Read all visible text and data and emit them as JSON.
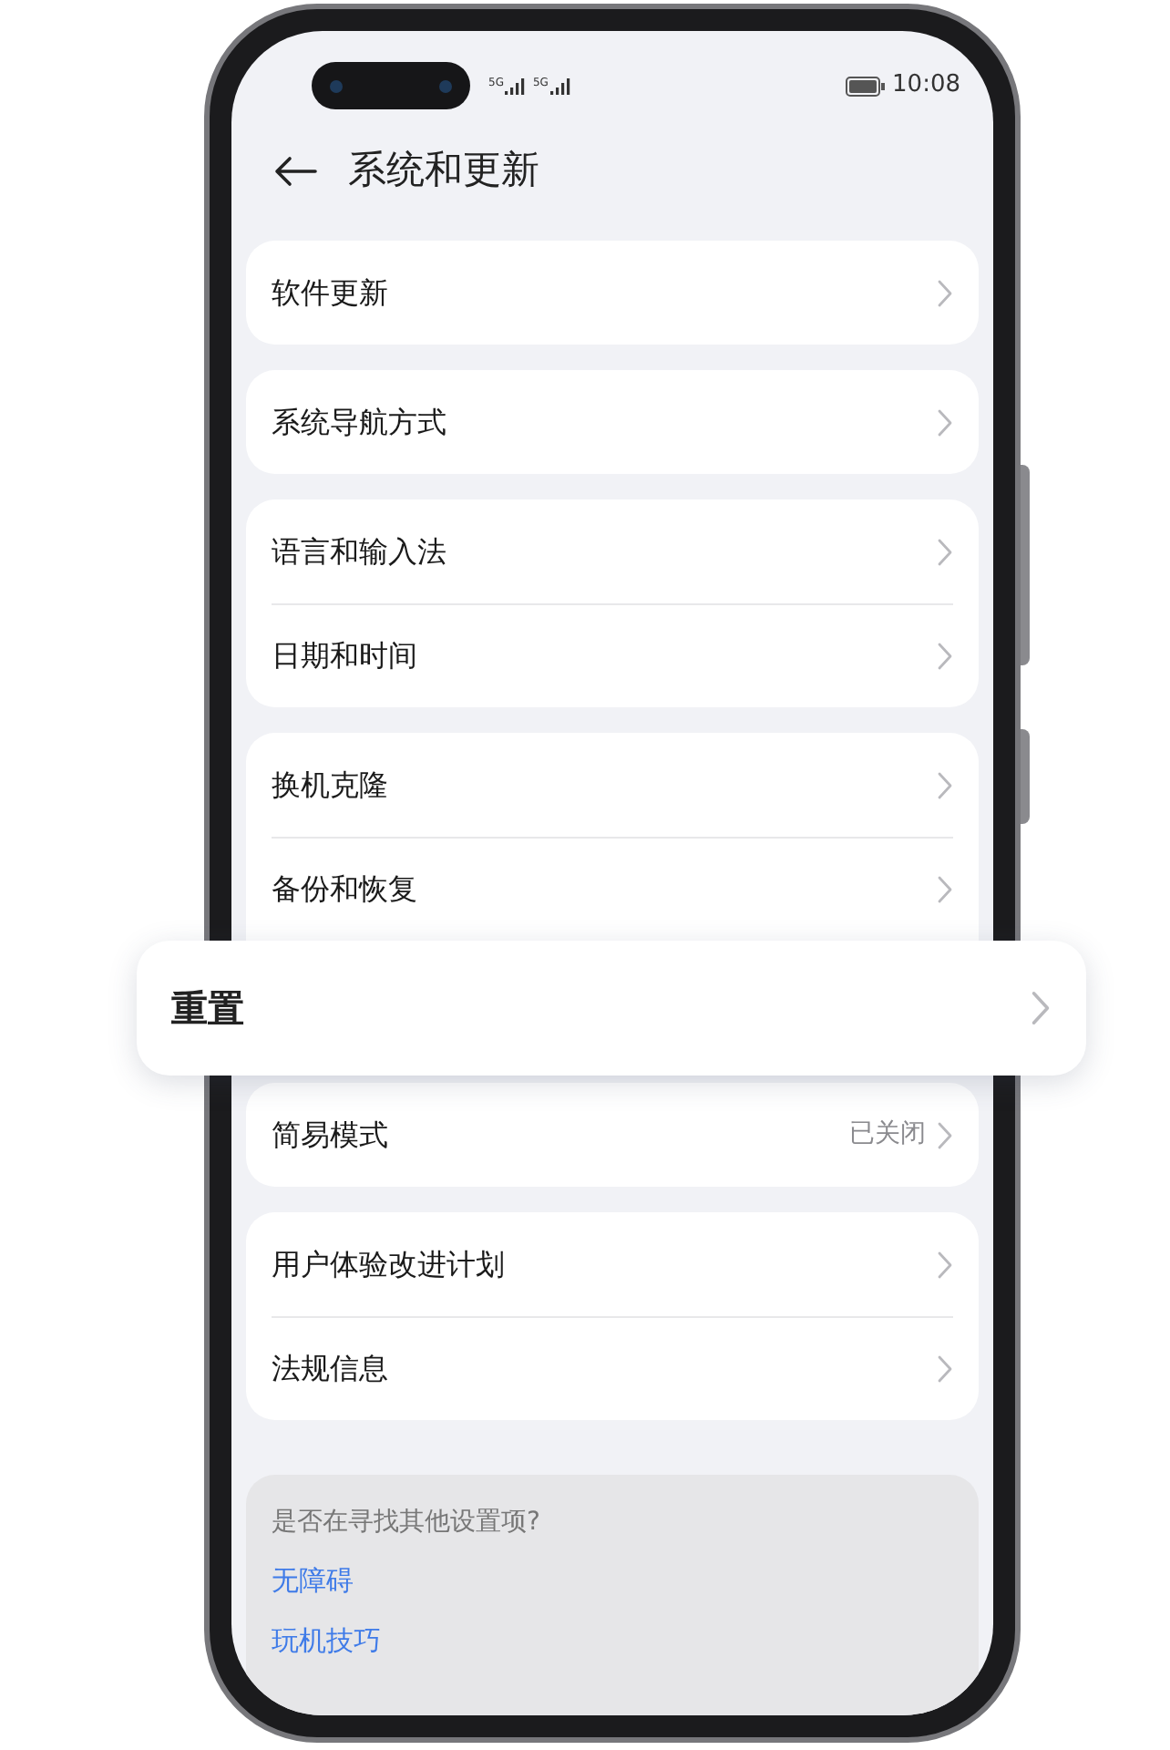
{
  "status_bar": {
    "signals": [
      "5G",
      "5G"
    ],
    "time": "10:08"
  },
  "header": {
    "title": "系统和更新"
  },
  "groups": [
    {
      "items": [
        {
          "label": "软件更新"
        }
      ]
    },
    {
      "items": [
        {
          "label": "系统导航方式"
        }
      ]
    },
    {
      "items": [
        {
          "label": "语言和输入法"
        },
        {
          "label": "日期和时间"
        }
      ]
    },
    {
      "items": [
        {
          "label": "换机克隆"
        },
        {
          "label": "备份和恢复"
        },
        {
          "label": "重置",
          "kind": "highlighted"
        }
      ]
    },
    {
      "items": [
        {
          "label": "简易模式",
          "value": "已关闭"
        }
      ]
    },
    {
      "items": [
        {
          "label": "用户体验改进计划"
        },
        {
          "label": "法规信息"
        }
      ]
    }
  ],
  "suggestions": {
    "title": "是否在寻找其他设置项?",
    "links": [
      "无障碍",
      "玩机技巧"
    ]
  }
}
